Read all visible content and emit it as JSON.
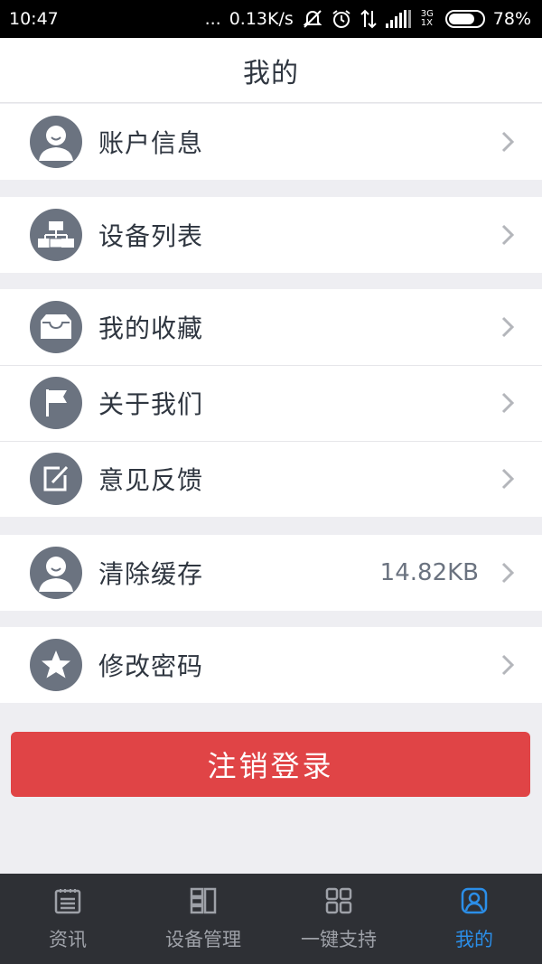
{
  "status_bar": {
    "time": "10:47",
    "dots": "...",
    "speed": "0.13K/s",
    "network": "3G 1X",
    "battery_level": 0.78,
    "battery_text": "78%"
  },
  "header": {
    "title": "我的"
  },
  "menu": {
    "account": {
      "label": "账户信息",
      "icon": "user-icon"
    },
    "devices": {
      "label": "设备列表",
      "icon": "device-list-icon"
    },
    "favorites": {
      "label": "我的收藏",
      "icon": "tray-icon"
    },
    "about": {
      "label": "关于我们",
      "icon": "flag-icon"
    },
    "feedback": {
      "label": "意见反馈",
      "icon": "edit-icon"
    },
    "cache": {
      "label": "清除缓存",
      "value": "14.82KB",
      "icon": "user-icon"
    },
    "password": {
      "label": "修改密码",
      "icon": "star-icon"
    }
  },
  "logout_label": "注销登录",
  "nav": {
    "items": [
      {
        "label": "资讯",
        "icon": "news-icon"
      },
      {
        "label": "设备管理",
        "icon": "device-manage-icon"
      },
      {
        "label": "一键支持",
        "icon": "grid-icon"
      },
      {
        "label": "我的",
        "icon": "profile-icon"
      }
    ],
    "active_index": 3,
    "active_color": "#2b8ee8",
    "inactive_color": "#9ea1a8"
  },
  "colors": {
    "accent_red": "#e04446",
    "icon_gray": "#6b7380",
    "background": "#eeeef2"
  }
}
